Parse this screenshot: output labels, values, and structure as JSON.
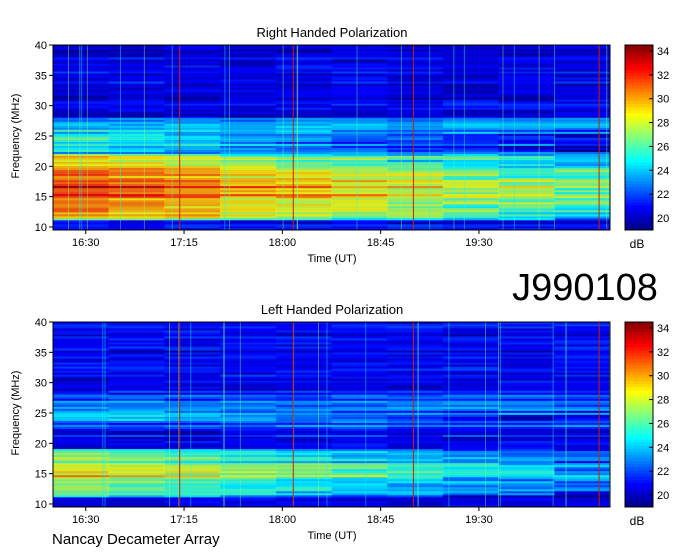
{
  "figure": {
    "observation_id": "J990108",
    "instrument": "Nancay Decameter Array"
  },
  "chart_data": [
    {
      "type": "heatmap",
      "title": "Right Handed Polarization",
      "xlabel": "Time (UT)",
      "ylabel": "Frequency (MHz)",
      "x_tick_labels": [
        "16:30",
        "17:15",
        "18:00",
        "18:45",
        "19:30"
      ],
      "x_ticks_minutes": [
        990,
        1035,
        1080,
        1125,
        1170
      ],
      "xlim_minutes": [
        975,
        1230
      ],
      "y_ticks": [
        10,
        15,
        20,
        25,
        30,
        35,
        40
      ],
      "ylim": [
        9.5,
        40
      ],
      "colorbar": {
        "label": "dB",
        "ticks": [
          20,
          22,
          24,
          26,
          28,
          30,
          32,
          34
        ],
        "range": [
          19,
          34.5
        ],
        "colormap": "jet"
      },
      "markers_minutes": [
        1033,
        1085,
        1140,
        1225
      ],
      "markers_color": "#cc2200",
      "emission_bands": [
        {
          "fmin": 11,
          "fmax": 22,
          "intensity": 34,
          "tstart": 975,
          "tend": 1230
        },
        {
          "fmin": 21,
          "fmax": 28,
          "intensity": 28,
          "tstart": 975,
          "tend": 1230
        }
      ]
    },
    {
      "type": "heatmap",
      "title": "Left Handed Polarization",
      "xlabel": "Time (UT)",
      "ylabel": "Frequency (MHz)",
      "x_tick_labels": [
        "16:30",
        "17:15",
        "18:00",
        "18:45",
        "19:30"
      ],
      "x_ticks_minutes": [
        990,
        1035,
        1080,
        1125,
        1170
      ],
      "xlim_minutes": [
        975,
        1230
      ],
      "y_ticks": [
        10,
        15,
        20,
        25,
        30,
        35,
        40
      ],
      "ylim": [
        9.5,
        40
      ],
      "colorbar": {
        "label": "dB",
        "ticks": [
          20,
          22,
          24,
          26,
          28,
          30,
          32,
          34
        ],
        "range": [
          19,
          34.5
        ],
        "colormap": "jet"
      },
      "markers_minutes": [
        1033,
        1085,
        1140,
        1225
      ],
      "markers_color": "#cc2200",
      "emission_bands": [
        {
          "fmin": 11,
          "fmax": 19,
          "intensity": 31,
          "tstart": 975,
          "tend": 1230
        },
        {
          "fmin": 21,
          "fmax": 29,
          "intensity": 26,
          "tstart": 975,
          "tend": 1230
        }
      ]
    }
  ]
}
